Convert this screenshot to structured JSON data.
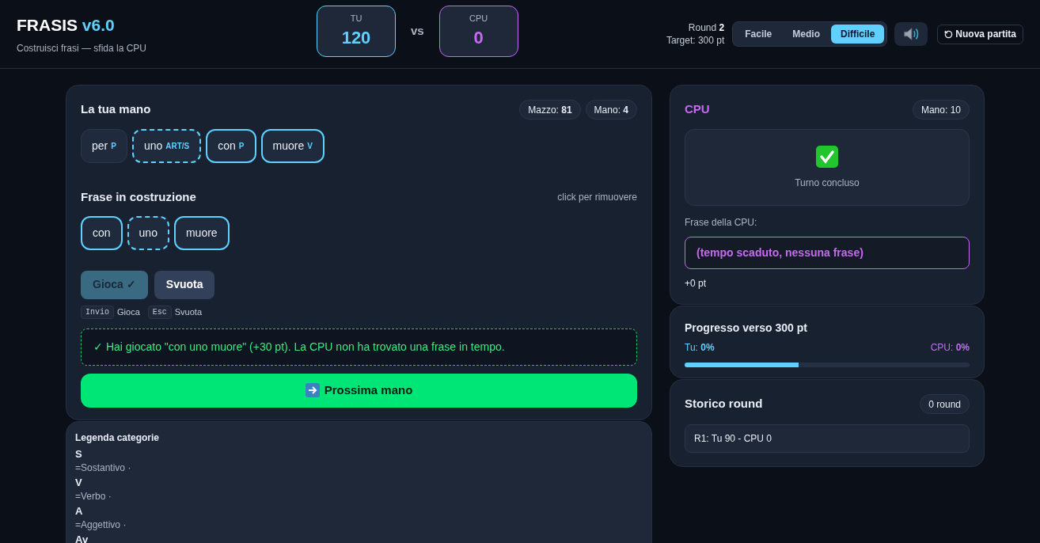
{
  "header": {
    "title": "FRASIS",
    "version": "v6.0",
    "subtitle": "Costruisci frasi — sfida la CPU",
    "scores": [
      {
        "label": "TU",
        "value": "120",
        "kind": "player"
      },
      {
        "label": "CPU",
        "value": "0",
        "kind": "cpu"
      }
    ],
    "vs": "vs",
    "round_label": "Round",
    "round": "2",
    "target": "Target: 300 pt",
    "difficulties": [
      {
        "label": "Facile",
        "selected": false
      },
      {
        "label": "Medio",
        "selected": false
      },
      {
        "label": "Difficile",
        "selected": true
      }
    ],
    "new_game": "Nuova partita"
  },
  "hand": {
    "title": "La tua mano",
    "badges": [
      {
        "label": "Mazzo:",
        "value": "81"
      },
      {
        "label": "Mano:",
        "value": "4"
      }
    ],
    "cards": [
      {
        "word": "per",
        "tag": "P",
        "in_phrase": false,
        "wildcard": false
      },
      {
        "word": "uno",
        "tag": "ART/S",
        "in_phrase": true,
        "wildcard": true
      },
      {
        "word": "con",
        "tag": "P",
        "in_phrase": true,
        "wildcard": false
      },
      {
        "word": "muore",
        "tag": "V",
        "in_phrase": true,
        "wildcard": false
      }
    ]
  },
  "phrase": {
    "title": "Frase in costruzione",
    "hint": "click per rimuovere",
    "cards": [
      {
        "word": "con",
        "wildcard": false
      },
      {
        "word": "uno",
        "wildcard": true
      },
      {
        "word": "muore",
        "wildcard": false
      }
    ]
  },
  "actions": {
    "play": {
      "label": "Gioca ✓",
      "disabled": true
    },
    "clear": {
      "label": "Svuota",
      "disabled": false
    },
    "shortcuts": [
      {
        "key": "Invio",
        "action": "Gioca"
      },
      {
        "key": "Esc",
        "action": "Svuota"
      }
    ]
  },
  "message": "✓ Hai giocato \"con uno muore\" (+30 pt). La CPU non ha trovato una frase in tempo.",
  "next_button": "Prossima mano",
  "legend": {
    "title": "Legenda categorie",
    "items": [
      {
        "code": "S",
        "label": "=Sostantivo ·"
      },
      {
        "code": "V",
        "label": "=Verbo ·"
      },
      {
        "code": "A",
        "label": "=Aggettivo ·"
      },
      {
        "code": "Av"
      }
    ]
  },
  "cpu": {
    "title": "CPU",
    "hand_badge": "Mano: 10",
    "status": "Turno concluso",
    "phrase_label": "Frase della CPU:",
    "phrase": "(tempo scaduto, nessuna frase)",
    "points": "+0 pt"
  },
  "progress": {
    "title": "Progresso verso 300 pt",
    "player_label": "Tu:",
    "player_value": "0%",
    "cpu_label": "CPU:",
    "cpu_value": "0%",
    "level": 0.4
  },
  "history": {
    "title": "Storico round",
    "count": "0 round",
    "rows": [
      "R1: Tu 90 - CPU 0"
    ]
  }
}
